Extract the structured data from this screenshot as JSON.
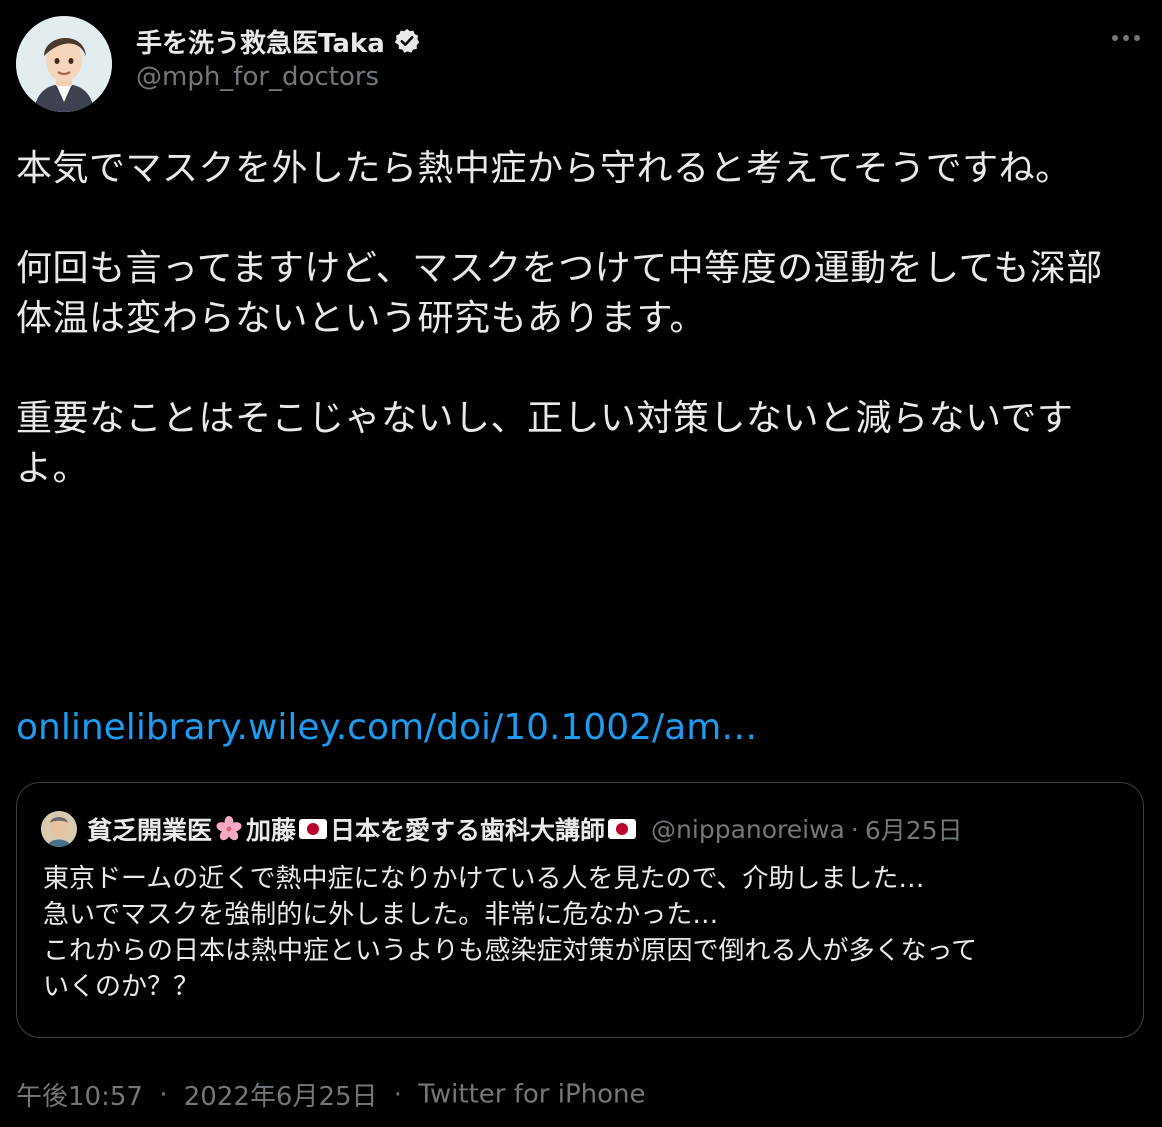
{
  "author": {
    "display_name": "手を洗う救急医Taka",
    "handle": "@mph_for_doctors",
    "verified": true
  },
  "tweet": {
    "paragraphs": [
      "本気でマスクを外したら熱中症から守れると考えてそうですね。",
      "何回も言ってますけど、マスクをつけて中等度の運動をしても深部体温は変わらないという研究もあります。",
      "重要なことはそこじゃないし、正しい対策しないと減らないですよ。"
    ],
    "link_text": "onlinelibrary.wiley.com/doi/10.1002/am…"
  },
  "quoted_tweet": {
    "name_part1": "貧乏開業医",
    "name_part2": "加藤",
    "name_part3": "日本を愛する歯科大講師",
    "handle": "@nippanoreiwa",
    "date": "6月25日",
    "dot": "·",
    "lines": [
      "東京ドームの近くで熱中症になりかけている人を見たので、介助しました…",
      "急いでマスクを強制的に外しました。非常に危なかった…",
      "これからの日本は熱中症というよりも感染症対策が原因で倒れる人が多くなって",
      "いくのか？？"
    ]
  },
  "meta": {
    "time": "午後10:57",
    "date": "2022年6月25日",
    "source": "Twitter for iPhone",
    "sep": "·"
  },
  "colors": {
    "background": "#000000",
    "text": "#e7e9ea",
    "secondary": "#71767b",
    "link": "#1d9bf0",
    "border": "#3b4045"
  },
  "icons": {
    "verified": "verified-badge-icon",
    "more": "more-icon",
    "flower": "cherry-blossom-icon",
    "flag": "japan-flag-icon"
  }
}
